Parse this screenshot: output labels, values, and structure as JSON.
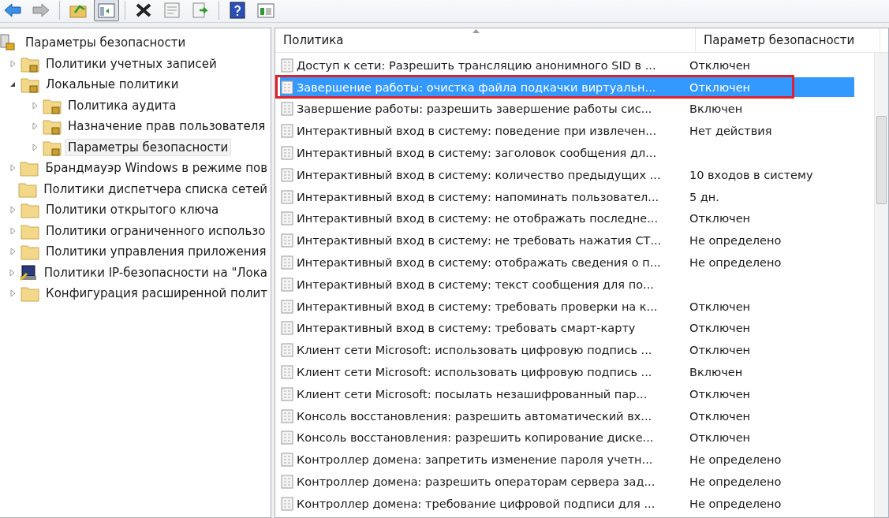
{
  "toolbar": [
    {
      "kind": "back",
      "pressed": false
    },
    {
      "kind": "forward",
      "pressed": false
    },
    {
      "kind": "sep"
    },
    {
      "kind": "up",
      "pressed": false
    },
    {
      "kind": "tree",
      "pressed": true
    },
    {
      "kind": "sep"
    },
    {
      "kind": "delete",
      "pressed": false
    },
    {
      "kind": "properties",
      "pressed": false
    },
    {
      "kind": "export",
      "pressed": false
    },
    {
      "kind": "sep"
    },
    {
      "kind": "help",
      "pressed": false
    },
    {
      "kind": "view",
      "pressed": false
    }
  ],
  "tree": [
    {
      "label": "Параметры безопасности",
      "kind": "security",
      "selected": false,
      "children": [
        {
          "label": "Политики учетных записей",
          "kind": "lock-folder",
          "expanded": false,
          "selected": false
        },
        {
          "label": "Локальные политики",
          "kind": "lock-folder",
          "expanded": true,
          "selected": false,
          "children": [
            {
              "label": "Политика аудита",
              "kind": "lock-folder",
              "expanded": false,
              "selected": false
            },
            {
              "label": "Назначение прав пользователя",
              "kind": "lock-folder",
              "expanded": false,
              "selected": false
            },
            {
              "label": "Параметры безопасности",
              "kind": "lock-folder",
              "expanded": false,
              "selected": true
            }
          ]
        },
        {
          "label": "Брандмауэр Windows в режиме пов",
          "kind": "folder",
          "expanded": false,
          "selected": false
        },
        {
          "label": "Политики диспетчера списка сетей",
          "kind": "folder",
          "selected": false
        },
        {
          "label": "Политики открытого ключа",
          "kind": "folder",
          "expanded": false,
          "selected": false
        },
        {
          "label": "Политики ограниченного использо",
          "kind": "folder",
          "expanded": false,
          "selected": false
        },
        {
          "label": "Политики управления приложения",
          "kind": "folder",
          "expanded": false,
          "selected": false
        },
        {
          "label": "Политики IP-безопасности на \"Лока",
          "kind": "ip-security",
          "expanded": false,
          "selected": false
        },
        {
          "label": "Конфигурация расширенной полит",
          "kind": "folder",
          "expanded": false,
          "selected": false
        }
      ]
    }
  ],
  "table": {
    "columns": [
      "Политика",
      "Параметр безопасности"
    ],
    "rows": [
      {
        "policy": "Доступ к сети: Разрешить трансляцию анонимного SID в ...",
        "setting": "Отключен",
        "selected": false
      },
      {
        "policy": "Завершение работы: очистка файла подкачки виртуальн...",
        "setting": "Отключен",
        "selected": true,
        "outlined": true
      },
      {
        "policy": "Завершение работы: разрешить завершение работы сис...",
        "setting": "Включен",
        "selected": false
      },
      {
        "policy": "Интерактивный вход в систему:  поведение при извлечен...",
        "setting": "Нет действия",
        "selected": false
      },
      {
        "policy": "Интерактивный вход в систему: заголовок сообщения дл...",
        "selected": false
      },
      {
        "policy": "Интерактивный вход в систему: количество предыдущих ...",
        "setting": "10 входов в систему",
        "selected": false
      },
      {
        "policy": "Интерактивный вход в систему: напоминать пользовател...",
        "setting": "5 дн.",
        "selected": false
      },
      {
        "policy": "Интерактивный вход в систему: не отображать последне...",
        "setting": "Отключен",
        "selected": false
      },
      {
        "policy": "Интерактивный вход в систему: не требовать нажатия СТ...",
        "setting": "Не определено",
        "selected": false
      },
      {
        "policy": "Интерактивный вход в систему: отображать сведения о п...",
        "setting": "Не определено",
        "selected": false
      },
      {
        "policy": "Интерактивный вход в систему: текст сообщения для по...",
        "selected": false
      },
      {
        "policy": "Интерактивный вход в систему: требовать проверки на к...",
        "setting": "Отключен",
        "selected": false
      },
      {
        "policy": "Интерактивный вход в систему: требовать смарт-карту",
        "setting": "Отключен",
        "selected": false
      },
      {
        "policy": "Клиент сети Microsoft: использовать цифровую подпись ...",
        "setting": "Отключен",
        "selected": false
      },
      {
        "policy": "Клиент сети Microsoft: использовать цифровую подпись ...",
        "setting": "Включен",
        "selected": false
      },
      {
        "policy": "Клиент сети Microsoft: посылать незашифрованный пар...",
        "setting": "Отключен",
        "selected": false
      },
      {
        "policy": "Консоль восстановления: разрешить автоматический вх...",
        "setting": "Отключен",
        "selected": false
      },
      {
        "policy": "Консоль восстановления: разрешить копирование диске...",
        "setting": "Отключен",
        "selected": false
      },
      {
        "policy": "Контроллер домена: запретить изменение пароля учетн...",
        "setting": "Не определено",
        "selected": false
      },
      {
        "policy": "Контроллер домена: разрешить операторам сервера зад...",
        "setting": "Не определено",
        "selected": false
      },
      {
        "policy": "Контроллер домена: требование цифровой подписи для ...",
        "setting": "Не определено",
        "selected": false
      }
    ]
  }
}
